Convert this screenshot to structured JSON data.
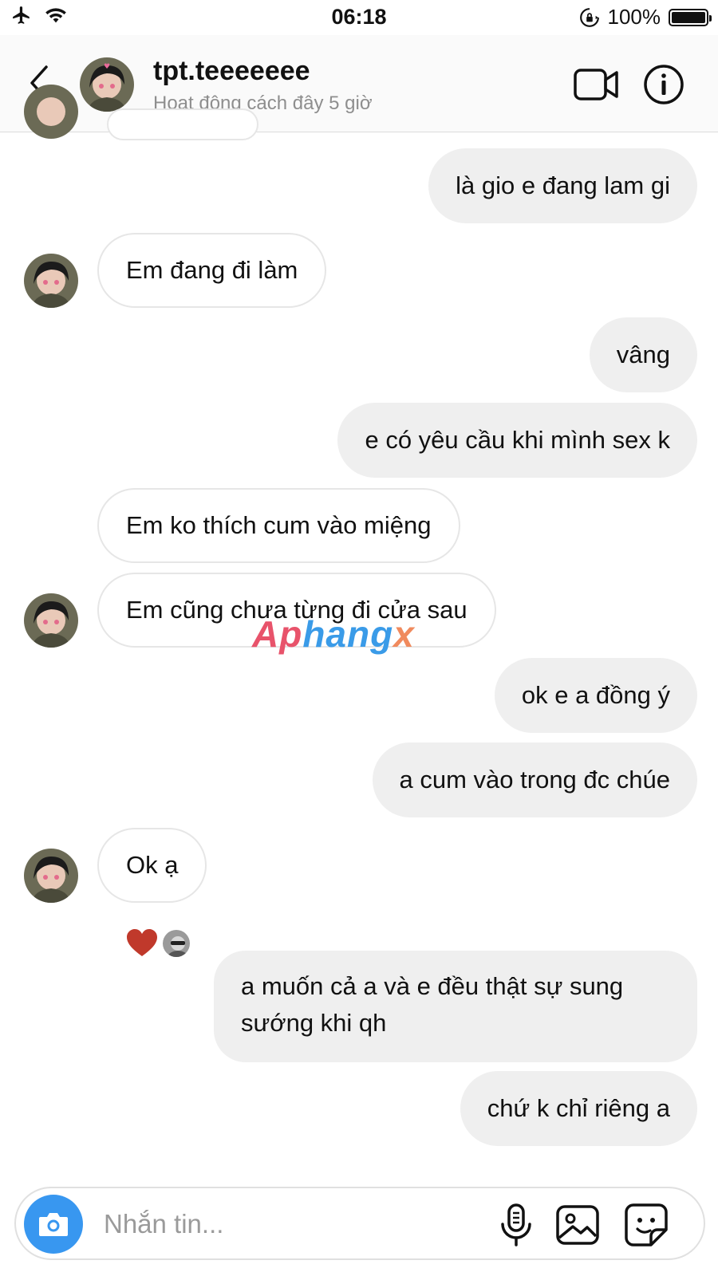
{
  "status_bar": {
    "time": "06:18",
    "battery": "100%",
    "icons": [
      "airplane-icon",
      "wifi-icon",
      "orientation-lock-icon",
      "battery-icon"
    ]
  },
  "header": {
    "username": "tpt.teeeeeee",
    "activity": "Hoạt động cách đây 5 giờ",
    "icons": [
      "back-icon",
      "video-call-icon",
      "info-icon"
    ]
  },
  "messages": [
    {
      "sender": "me",
      "text": "là gio e đang lam gi"
    },
    {
      "sender": "them",
      "text": "Em đang đi làm"
    },
    {
      "sender": "me",
      "text": "vâng"
    },
    {
      "sender": "me",
      "text": "e có yêu cầu khi mình sex k"
    },
    {
      "sender": "them",
      "text": "Em ko thích cum vào miệng"
    },
    {
      "sender": "them",
      "text": "Em cũng chưa từng đi cửa sau"
    },
    {
      "sender": "me",
      "text": "ok e a đồng ý"
    },
    {
      "sender": "me",
      "text": "a cum vào trong đc chúe"
    },
    {
      "sender": "them",
      "text": "Ok ạ",
      "reaction": "heart"
    },
    {
      "sender": "me",
      "text": "a muốn cả a và e đều thật sự sung sướng khi qh"
    },
    {
      "sender": "me",
      "text": "chứ k chỉ riêng a"
    }
  ],
  "watermark": {
    "part1": "Ap",
    "part2": "hang",
    "part3": "x"
  },
  "composer": {
    "placeholder": "Nhắn tin...",
    "icons": [
      "camera-icon",
      "microphone-icon",
      "gallery-icon",
      "sticker-icon"
    ]
  },
  "colors": {
    "sent_bubble": "#efefef",
    "received_bubble_border": "#e6e6e6",
    "camera_button": "#3897f0",
    "heart": "#c0392b",
    "secondary_text": "#8e8e8e"
  }
}
